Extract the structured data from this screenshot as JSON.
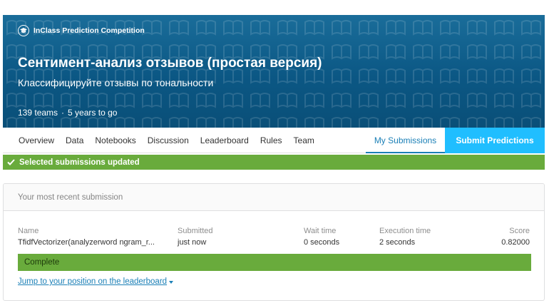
{
  "banner": {
    "competition_type": "InClass Prediction Competition",
    "title": "Сентимент-анализ отзывов (простая версия)",
    "subtitle": "Классифицируйте отзывы по тональности",
    "teams": "139 teams",
    "separator": "·",
    "age": "5 years to go",
    "background_color": "#0b5784"
  },
  "tabs": {
    "items": [
      {
        "key": "overview",
        "label": "Overview"
      },
      {
        "key": "data",
        "label": "Data"
      },
      {
        "key": "notebooks",
        "label": "Notebooks"
      },
      {
        "key": "discussion",
        "label": "Discussion"
      },
      {
        "key": "leaderboard",
        "label": "Leaderboard"
      },
      {
        "key": "rules",
        "label": "Rules"
      },
      {
        "key": "team",
        "label": "Team"
      }
    ],
    "my_submissions": "My Submissions",
    "submit_predictions": "Submit Predictions",
    "accent_color": "#20beff",
    "active_color": "#1a7fb6"
  },
  "alert": {
    "icon": "check-icon",
    "message": "Selected submissions updated",
    "color": "#69ab3c"
  },
  "submission": {
    "header": "Your most recent submission",
    "columns": {
      "name": "Name",
      "submitted": "Submitted",
      "wait_time": "Wait time",
      "execution_time": "Execution time",
      "score": "Score"
    },
    "values": {
      "name": "TfidfVectorizer(analyzerword ngram_r...",
      "submitted": "just now",
      "wait_time": "0 seconds",
      "execution_time": "2 seconds",
      "score": "0.82000"
    },
    "status": "Complete",
    "jump_link": "Jump to your position on the leaderboard"
  }
}
